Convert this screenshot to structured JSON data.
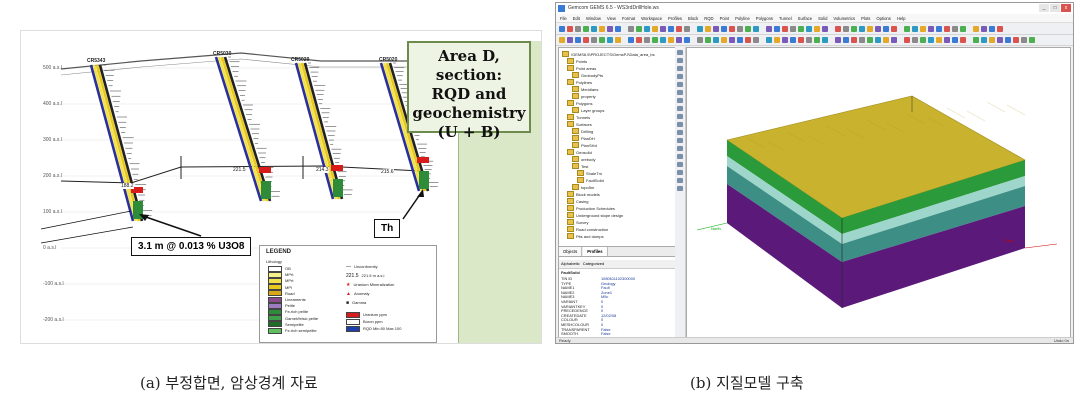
{
  "panel_a": {
    "title_lines": [
      "Area D, section:",
      "RQD and",
      "geochemistry",
      "(U + B)"
    ],
    "annotation_u3o8": "3.1 m @ 0.013 % U3O8",
    "annotation_th": "Th",
    "holes": [
      "CR5343",
      "CR5030",
      "CR5029",
      "CR5020"
    ],
    "depth_labels": [
      "188.2",
      "221.5",
      "214.3",
      "215.6"
    ],
    "elevations": [
      "500 a.s.l",
      "400 a.s.l",
      "300 a.s.l",
      "200 a.s.l",
      "100 a.s.l",
      "0 a.s.l",
      "-100 a.s.l",
      "-200 a.s.l"
    ],
    "legend": {
      "title": "LEGEND",
      "lithology_label": "Lithology",
      "lithology": [
        {
          "label": "OB",
          "color": "#ffffff"
        },
        {
          "label": "MPrt",
          "color": "#f5f08a"
        },
        {
          "label": "MPrt",
          "color": "#f2e24a"
        },
        {
          "label": "MPl",
          "color": "#e8c818"
        },
        {
          "label": "Road",
          "color": "#d9a818"
        },
        {
          "label": "Lineaments",
          "color": "#8b4a8c"
        },
        {
          "label": "Pelite",
          "color": "#9c7cc0"
        },
        {
          "label": "Fe-rich pelite",
          "color": "#2e8b3a"
        },
        {
          "label": "Garnet/felsic pelite",
          "color": "#3fa04a"
        },
        {
          "label": "Semipelite",
          "color": "#1e6b2a"
        },
        {
          "label": "Fe-rich semipelite",
          "color": "#5fbf5f"
        }
      ],
      "symbols": [
        "Unconformity",
        "221.5 m a.s.l",
        "Uranium Mineralization",
        "Anomaly",
        "Gamma"
      ],
      "ppm": [
        {
          "label": "Uranium ppm",
          "color": "#d81b1b"
        },
        {
          "label": "Boron ppm",
          "color": "#ffffff"
        },
        {
          "label": "RQD Min 80 Max 100",
          "color": "#1f3fa8"
        }
      ]
    }
  },
  "panel_b": {
    "window_title": "Gemcom GEMS 6.5 - WS3rdDrillHole.ws",
    "window_buttons": [
      "_",
      "□",
      "x"
    ],
    "menus": [
      "File",
      "Edit",
      "Window",
      "View",
      "Format",
      "Workspace",
      "Profiles",
      "Block",
      "RQD",
      "Point",
      "Polyline",
      "Polygons",
      "Tunnel",
      "Surface",
      "Solid",
      "Volumetrics",
      "Plots",
      "Options",
      "Help"
    ],
    "tree": [
      {
        "label": "\\GEMS6.5\\PROJECTS\\GemsPJ\\Data_area_bs",
        "indent": 0
      },
      {
        "label": "Points",
        "indent": 1
      },
      {
        "label": "Point areas",
        "indent": 1
      },
      {
        "label": "GeobodyPts",
        "indent": 2
      },
      {
        "label": "Polylines",
        "indent": 1
      },
      {
        "label": "Meridians",
        "indent": 2
      },
      {
        "label": "property",
        "indent": 2
      },
      {
        "label": "Polygons",
        "indent": 1
      },
      {
        "label": "Layer groups",
        "indent": 2
      },
      {
        "label": "Tunnels",
        "indent": 1
      },
      {
        "label": "Surfaces",
        "indent": 1
      },
      {
        "label": "Drilling",
        "indent": 2
      },
      {
        "label": "PlanDH",
        "indent": 2
      },
      {
        "label": "PlanSHd",
        "indent": 2
      },
      {
        "label": "Geosolid",
        "indent": 1
      },
      {
        "label": "orebody",
        "indent": 2
      },
      {
        "label": "Test",
        "indent": 2
      },
      {
        "label": "ShaleTm",
        "indent": 3
      },
      {
        "label": "FaultSolid",
        "indent": 3
      },
      {
        "label": "topo5m",
        "indent": 2
      },
      {
        "label": "Block models",
        "indent": 1
      },
      {
        "label": "Casing",
        "indent": 1
      },
      {
        "label": "Production Schedules",
        "indent": 1
      },
      {
        "label": "Underground stope design",
        "indent": 1
      },
      {
        "label": "Survey",
        "indent": 1
      },
      {
        "label": "Road construction",
        "indent": 1
      },
      {
        "label": "Pits and dumps",
        "indent": 1
      }
    ],
    "tabs": [
      "Objects",
      "Profiles"
    ],
    "prop_tabs": [
      "Alphabetic",
      "Categorized"
    ],
    "prop_header": "FaultSolid",
    "properties": [
      {
        "key": "TIN ID",
        "value": "1080611102300000"
      },
      {
        "key": "TYPE",
        "value": "Geology"
      },
      {
        "key": "NAME1",
        "value": "Fault"
      },
      {
        "key": "NAME2",
        "value": "Zone1"
      },
      {
        "key": "NAME3",
        "value": "M5c"
      },
      {
        "key": "VARIANT",
        "value": "0"
      },
      {
        "key": "VARIANTKEY",
        "value": "0"
      },
      {
        "key": "PRECEDENCE",
        "value": "0"
      },
      {
        "key": "CREATEDATE",
        "value": "12/02/08"
      },
      {
        "key": "COLOUR",
        "value": "0"
      },
      {
        "key": "MESHCOLOUR",
        "value": "0"
      },
      {
        "key": "TRANSPARENT",
        "value": "False"
      },
      {
        "key": "SMOOTH",
        "value": "False"
      }
    ],
    "axis_labels": {
      "x": "East",
      "y": "North"
    },
    "status_left": "Ready",
    "status_right": "Undo 0n",
    "model_colors": {
      "top": "#c9b22e",
      "top_dark": "#a48f1e",
      "layer1": "#2a9a3a",
      "layer2": "#9fd6cc",
      "layer3": "#3d8f86",
      "layer4": "#5b1a7a"
    }
  },
  "captions": {
    "a": "(a) 부정합면, 암상경계 자료",
    "b": "(b) 지질모델 구축"
  }
}
